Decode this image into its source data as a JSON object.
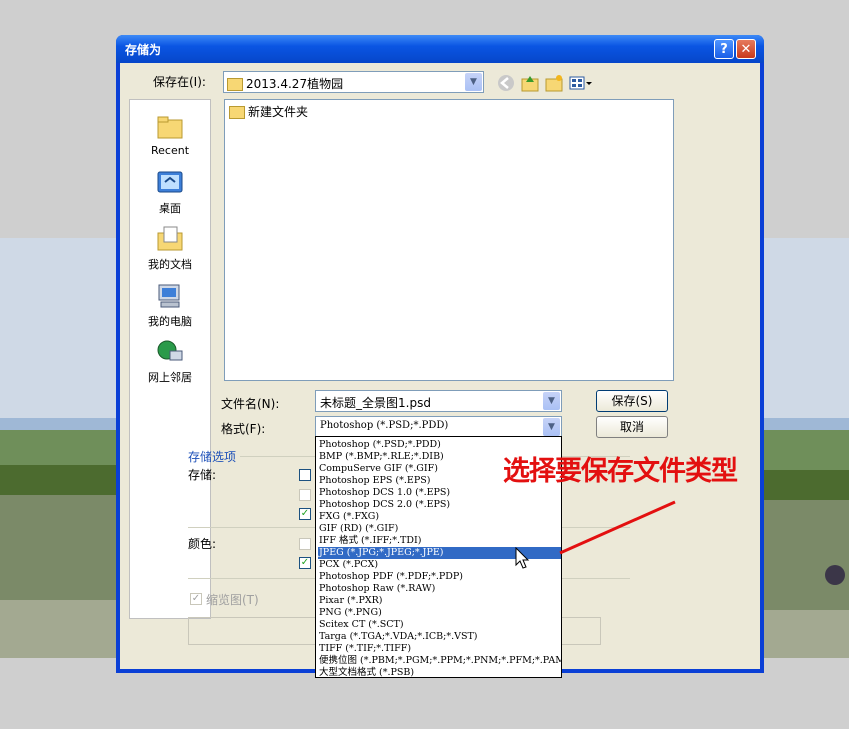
{
  "dialog": {
    "title": "存储为",
    "help": "?",
    "close": "✕"
  },
  "save_in": {
    "label": "保存在(I):",
    "value": "2013.4.27植物园"
  },
  "places": [
    {
      "label": "Recent"
    },
    {
      "label": "桌面"
    },
    {
      "label": "我的文档"
    },
    {
      "label": "我的电脑"
    },
    {
      "label": "网上邻居"
    }
  ],
  "files": [
    {
      "name": "新建文件夹"
    }
  ],
  "filename": {
    "label": "文件名(N):",
    "value": "未标题_全景图1.psd"
  },
  "format": {
    "label": "格式(F):",
    "value": "Photoshop (*.PSD;*.PDD)"
  },
  "buttons": {
    "save": "保存(S)",
    "cancel": "取消"
  },
  "options": {
    "group_title": "存储选项",
    "save_label": "存储:",
    "color_label": "颜色:",
    "thumbnail_label": "缩览图(T)"
  },
  "format_options": [
    "Photoshop (*.PSD;*.PDD)",
    "BMP (*.BMP;*.RLE;*.DIB)",
    "CompuServe GIF (*.GIF)",
    "Photoshop EPS (*.EPS)",
    "Photoshop DCS 1.0 (*.EPS)",
    "Photoshop DCS 2.0 (*.EPS)",
    "FXG (*.FXG)",
    "GIF (RD) (*.GIF)",
    "IFF 格式 (*.IFF;*.TDI)",
    "JPEG (*.JPG;*.JPEG;*.JPE)",
    "PCX (*.PCX)",
    "Photoshop PDF (*.PDF;*.PDP)",
    "Photoshop Raw (*.RAW)",
    "Pixar (*.PXR)",
    "PNG (*.PNG)",
    "Scitex CT (*.SCT)",
    "Targa (*.TGA;*.VDA;*.ICB;*.VST)",
    "TIFF (*.TIF;*.TIFF)",
    "便携位图 (*.PBM;*.PGM;*.PPM;*.PNM;*.PFM;*.PAM)",
    "大型文档格式 (*.PSB)"
  ],
  "selected_format": "JPEG (*.JPG;*.JPEG;*.JPE)",
  "annotation": "选择要保存文件类型",
  "colors": {
    "annotation": "#e31010",
    "selection": "#316ac5",
    "titlebar": "#0a55e3"
  }
}
